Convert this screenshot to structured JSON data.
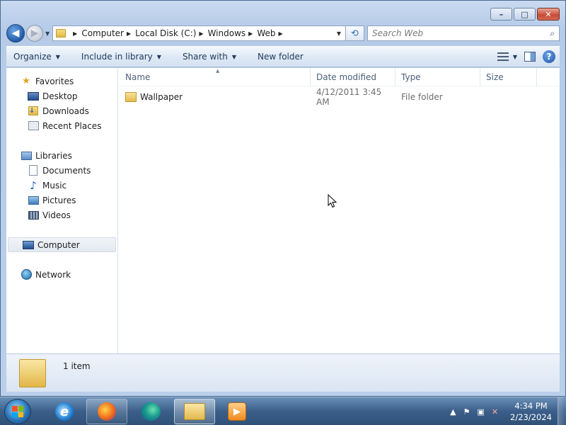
{
  "window": {
    "controls": {
      "minimize": "–",
      "maximize": "□",
      "close": "✕"
    }
  },
  "navbar": {
    "back_glyph": "◀",
    "forward_glyph": "▶",
    "recent_glyph": "▼",
    "breadcrumbs": [
      "Computer",
      "Local Disk (C:)",
      "Windows",
      "Web"
    ],
    "crumb_separator": "▶",
    "dropdown_glyph": "▼",
    "refresh_glyph": "⟲",
    "search_placeholder": "Search Web",
    "search_glyph": "⌕"
  },
  "toolbar": {
    "organize": "Organize",
    "include_in_library": "Include in library",
    "share_with": "Share with",
    "new_folder": "New folder",
    "caret": "▼",
    "views_caret": "▼",
    "help": "?"
  },
  "nav_pane": {
    "favorites": {
      "label": "Favorites",
      "icon_glyph": "★",
      "items": [
        "Desktop",
        "Downloads",
        "Recent Places"
      ]
    },
    "libraries": {
      "label": "Libraries",
      "items": [
        "Documents",
        "Music",
        "Pictures",
        "Videos"
      ]
    },
    "computer": "Computer",
    "network": "Network",
    "music_glyph": "♪",
    "downloads_glyph": "↓"
  },
  "columns": {
    "name": "Name",
    "date_modified": "Date modified",
    "type": "Type",
    "size": "Size",
    "sort_indicator": "▲"
  },
  "files": [
    {
      "name": "Wallpaper",
      "date_modified": "4/12/2011 3:45 AM",
      "type": "File folder",
      "size": ""
    }
  ],
  "details": {
    "item_count": "1 item"
  },
  "taskbar": {
    "wmp_glyph": "▶",
    "tray": {
      "show_hidden": "▲",
      "flag": "⚑",
      "network": "▣",
      "volume": "✕"
    },
    "clock": {
      "time": "4:34 PM",
      "date": "2/23/2024"
    }
  },
  "colors": {
    "accent": "#1e395b",
    "title_bar": "#b9cfea",
    "close_button": "#c74a36",
    "taskbar": "#3b5f8a"
  }
}
